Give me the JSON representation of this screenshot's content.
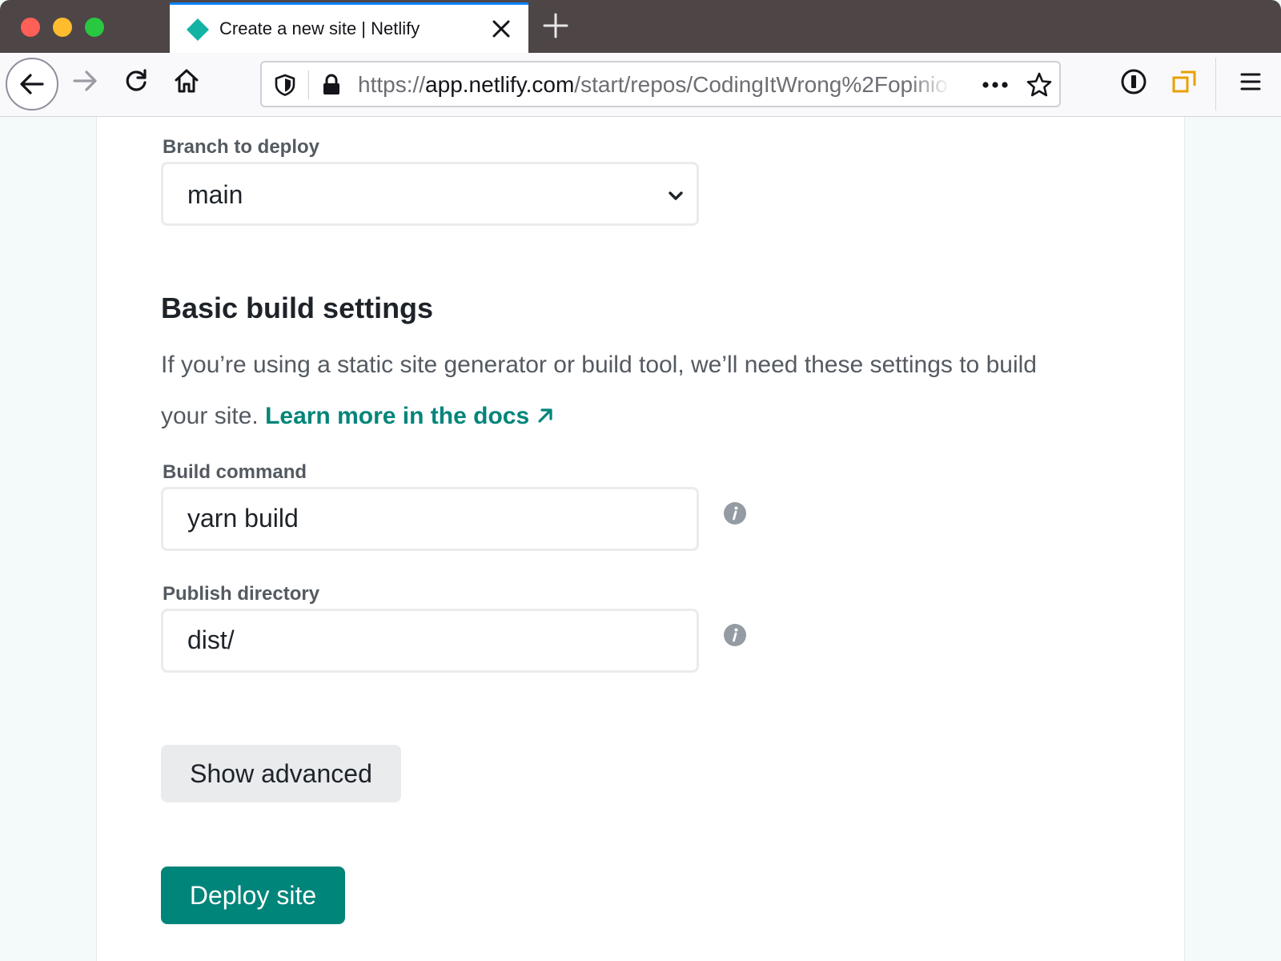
{
  "browser": {
    "tab": {
      "title": "Create a new site | Netlify",
      "favicon": "netlify-diamond-icon",
      "favicon_color": "#13b3a4"
    },
    "url": {
      "scheme": "https://",
      "host": "app.netlify.com",
      "path": "/start/repos/CodingItWrong%2Fopinio"
    },
    "toolbar_icons": [
      "back-arrow-icon",
      "forward-arrow-icon",
      "reload-icon",
      "home-icon",
      "tracking-shield-icon",
      "lock-icon",
      "more-dots-icon",
      "star-icon",
      "1password-icon",
      "extension-icon",
      "hamburger-menu-icon"
    ]
  },
  "form": {
    "branch": {
      "label": "Branch to deploy",
      "value": "main"
    },
    "section": {
      "title": "Basic build settings",
      "description": "If you’re using a static site generator or build tool, we’ll need these settings to build your site.",
      "docs_link": "Learn more in the docs"
    },
    "build_command": {
      "label": "Build command",
      "value": "yarn build"
    },
    "publish_directory": {
      "label": "Publish directory",
      "value": "dist/"
    },
    "show_advanced_label": "Show advanced",
    "deploy_label": "Deploy site"
  },
  "colors": {
    "accent": "#00857a",
    "tabstrip": "#4e4546",
    "page_background": "#f4f9f9"
  }
}
